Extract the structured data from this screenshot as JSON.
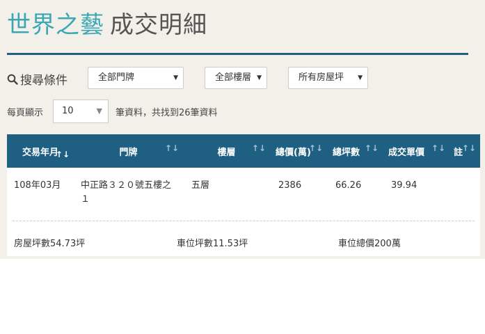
{
  "header": {
    "title_accent": "世界之藝",
    "title_rest": "成交明細"
  },
  "filters": {
    "label": "搜尋條件",
    "door": "全部門牌",
    "floor": "全部樓層",
    "area": "所有房屋坪"
  },
  "pagination": {
    "per_page_label": "每頁顯示",
    "per_page_value": "10",
    "suffix": "筆資料，共找到26筆資料"
  },
  "table": {
    "headers": [
      "交易年月",
      "門牌",
      "樓層",
      "總價(萬)",
      "總坪數",
      "成交單價",
      "註"
    ],
    "rows": [
      {
        "date": "108年03月",
        "address": "中正路３２０號五樓之１",
        "floor": "五層",
        "total_price": "2386",
        "total_ping": "66.26",
        "unit_price": "39.94",
        "note": ""
      }
    ],
    "detail": {
      "house_ping": "房屋坪數54.73坪",
      "parking_ping": "車位坪數11.53坪",
      "parking_price": "車位總價200萬"
    }
  },
  "colors": {
    "accent": "#3aa7b6",
    "header_bg": "#1f5f82",
    "page_bg": "#f2f0e9"
  }
}
